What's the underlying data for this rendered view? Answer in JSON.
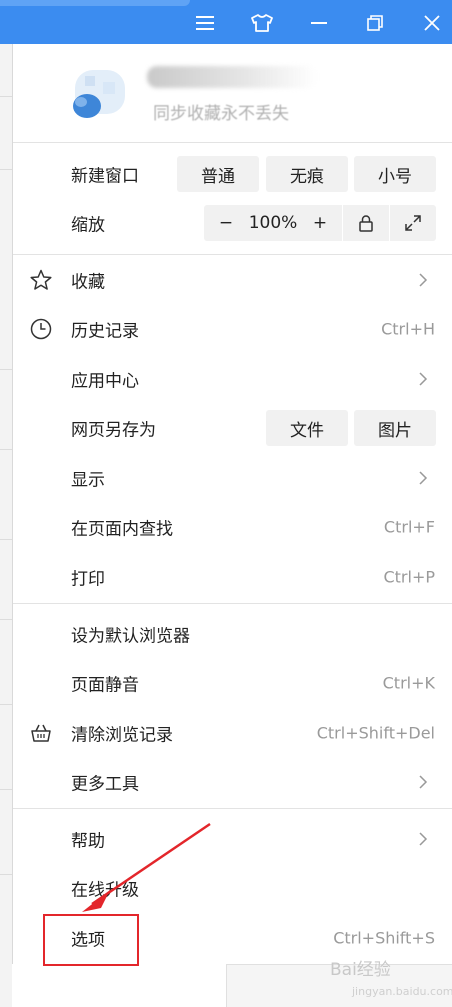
{
  "titlebar": {
    "color": "#3b8cf0",
    "icons": [
      "menu-icon",
      "skin-shirt-icon",
      "minimize-icon",
      "restore-icon",
      "close-icon"
    ]
  },
  "profile": {
    "subtitle": "同步收藏永不丢失"
  },
  "new_window": {
    "label": "新建窗口",
    "options": [
      "普通",
      "无痕",
      "小号"
    ]
  },
  "zoom": {
    "label": "缩放",
    "minus": "−",
    "value": "100%",
    "plus": "+"
  },
  "menu_items": {
    "favorites": {
      "label": "收藏",
      "icon": "star-icon"
    },
    "history": {
      "label": "历史记录",
      "shortcut": "Ctrl+H",
      "icon": "clock-icon"
    },
    "app_center": {
      "label": "应用中心"
    },
    "save_page": {
      "label": "网页另存为",
      "options": [
        "文件",
        "图片"
      ]
    },
    "display": {
      "label": "显示"
    },
    "find": {
      "label": "在页面内查找",
      "shortcut": "Ctrl+F"
    },
    "print": {
      "label": "打印",
      "shortcut": "Ctrl+P"
    },
    "default_browser": {
      "label": "设为默认浏览器"
    },
    "mute": {
      "label": "页面静音",
      "shortcut": "Ctrl+K"
    },
    "clear_history": {
      "label": "清除浏览记录",
      "shortcut": "Ctrl+Shift+Del",
      "icon": "broom-basket-icon"
    },
    "more_tools": {
      "label": "更多工具"
    },
    "help": {
      "label": "帮助"
    },
    "update": {
      "label": "在线升级"
    },
    "options": {
      "label": "选项",
      "shortcut": "Ctrl+Shift+S"
    }
  },
  "annotation": {
    "color": "#e3262b"
  },
  "watermark": {
    "text": "Bai经验",
    "sub": "jingyan.baidu.com"
  }
}
